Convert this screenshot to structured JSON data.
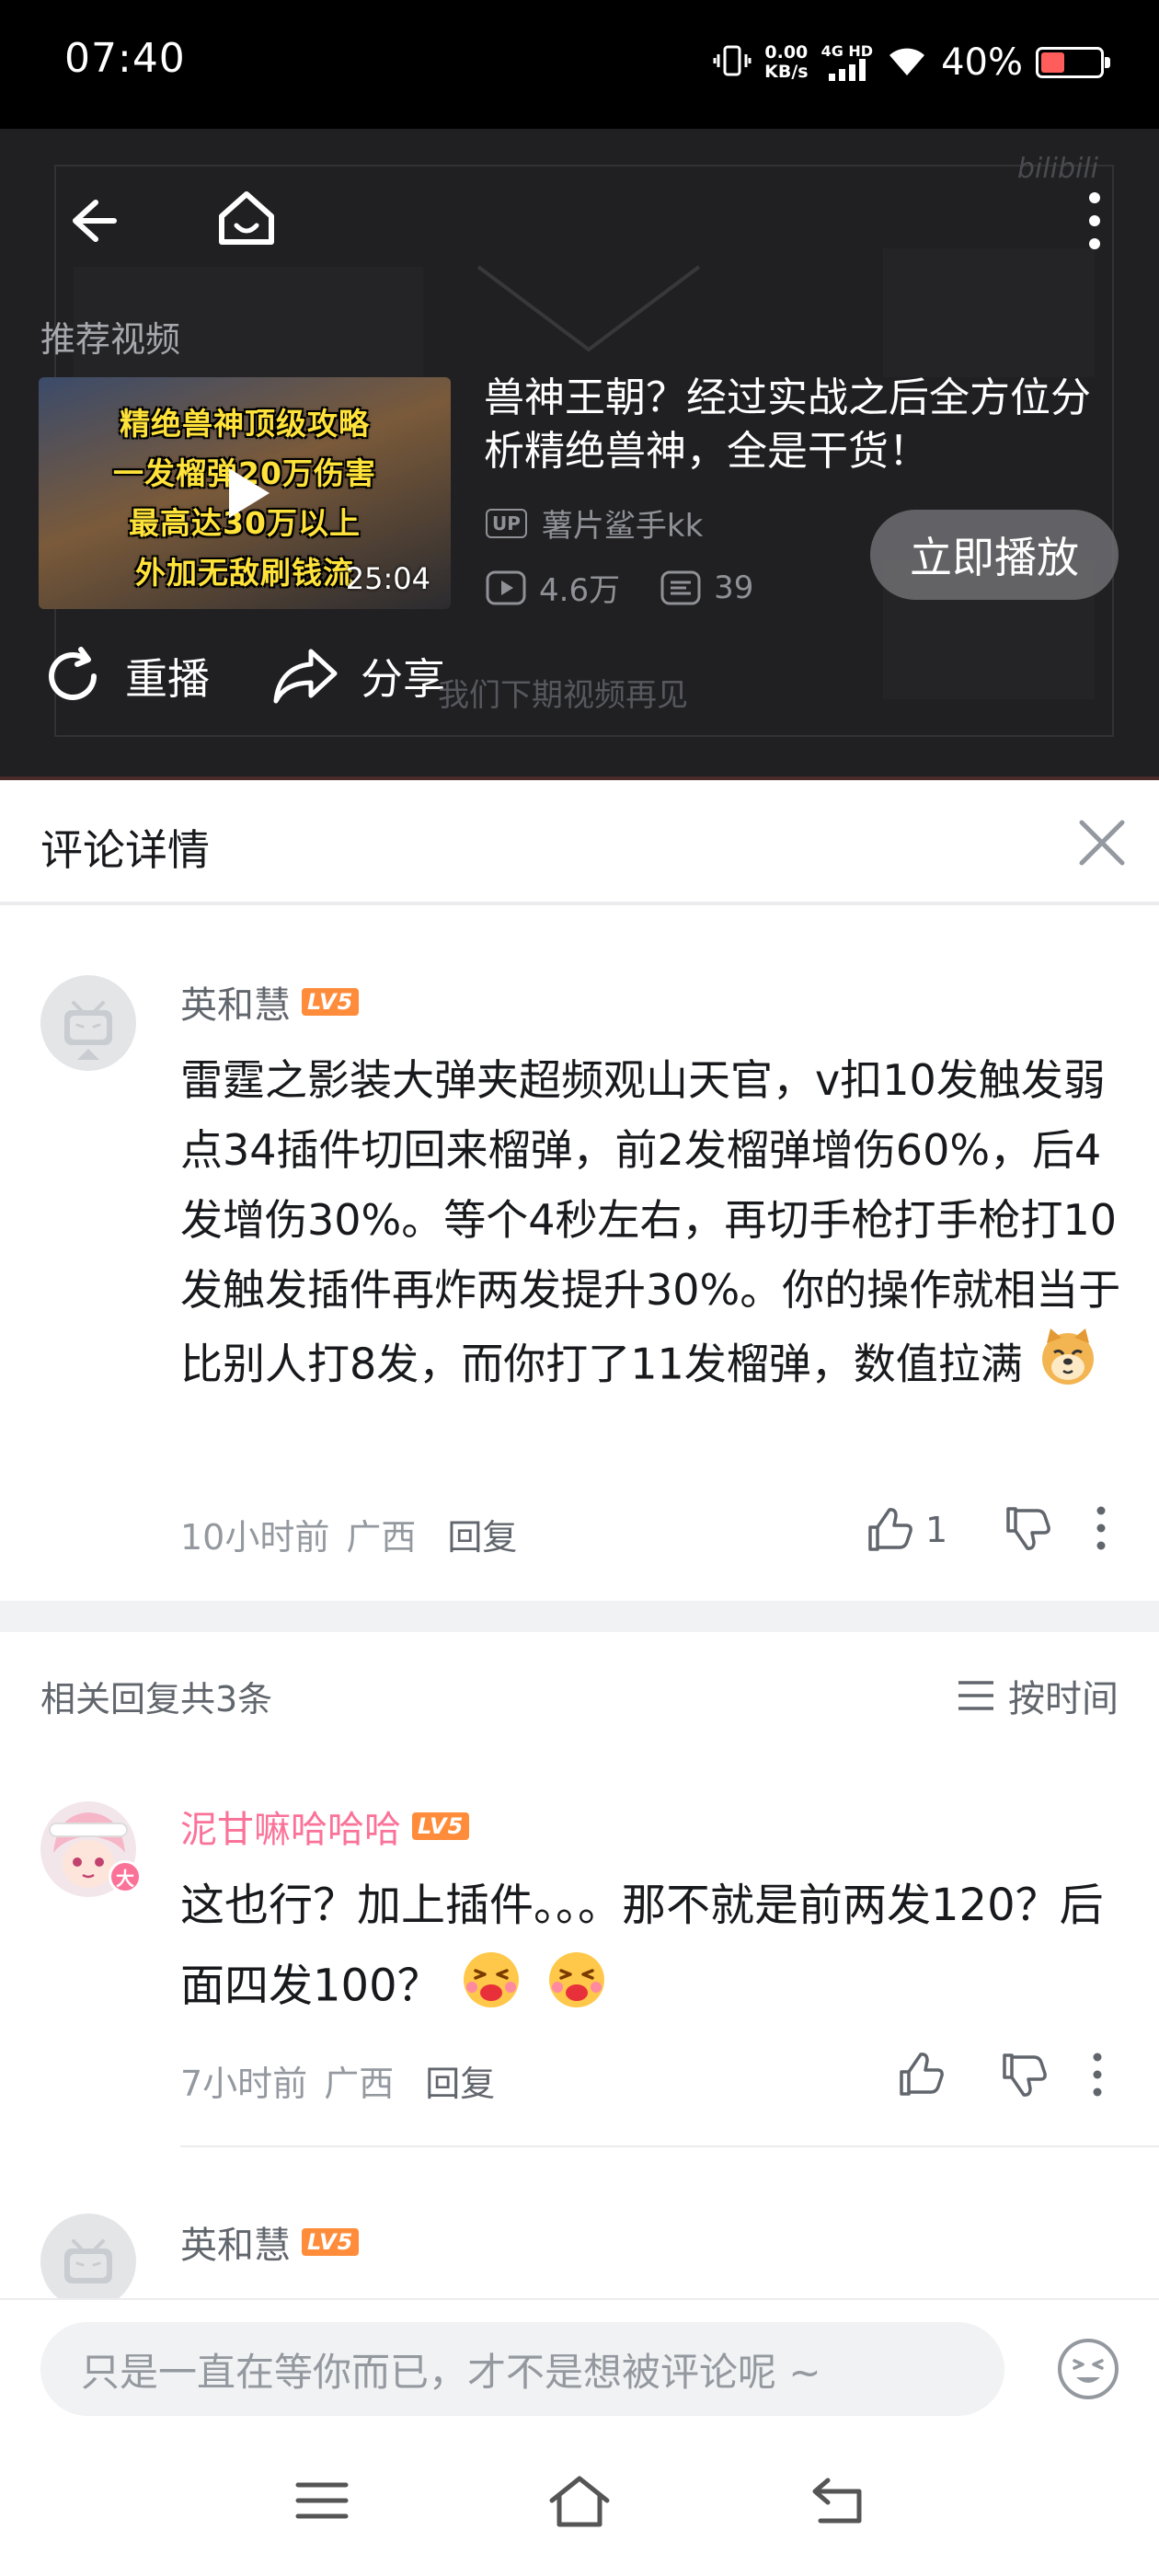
{
  "status_bar": {
    "time": "07:40",
    "net_speed_value": "0.00",
    "net_speed_unit": "KB/s",
    "network_type": "4G HD",
    "battery_percent": "40%",
    "battery_level": 0.4
  },
  "player": {
    "recommend_label": "推荐视频",
    "brand": "bilibili",
    "watermark_text": "我们下期视频再见",
    "video": {
      "thumb_lines": [
        "精绝兽神顶级攻略",
        "一发榴弹20万伤害",
        "最高达30万以上",
        "外加无敌刷钱流"
      ],
      "duration": "25:04",
      "title": "兽神王朝？经过实战之后全方位分析精绝兽神，全是干货！",
      "up_badge": "UP",
      "uploader": "薯片鲨手kk",
      "views": "4.6万",
      "danmaku": "39"
    },
    "play_now_label": "立即播放",
    "replay_label": "重播",
    "share_label": "分享"
  },
  "comment_header": {
    "title": "评论详情"
  },
  "main_comment": {
    "username": "英和慧",
    "level": "LV5",
    "text": "雷霆之影装大弹夹超频观山天官，v扣10发触发弱点34插件切回来榴弹，前2发榴弹增伤60%，后4发增伤30%。等个4秒左右，再切手枪打手枪打10发触发插件再炸两发提升30%。你的操作就相当于比别人打8发，而你打了11发榴弹，数值拉满",
    "time": "10小时前",
    "location": "广西",
    "reply_label": "回复",
    "likes": "1"
  },
  "replies_bar": {
    "count_label": "相关回复共3条",
    "sort_label": "按时间"
  },
  "replies": [
    {
      "username": "泥甘嘛哈哈哈",
      "level": "LV5",
      "badge": "大",
      "text": "这也行？加上插件。。。那不就是前两发120？后面四发100？",
      "time": "7小时前",
      "location": "广西",
      "reply_label": "回复"
    },
    {
      "username": "英和慧",
      "level": "LV5"
    }
  ],
  "input_bar": {
    "placeholder": "只是一直在等你而已，才不是想被评论呢 ~"
  },
  "colors": {
    "pink": "#fb7299",
    "level_orange": "#ff8c3a",
    "battery_low": "#ff5c5c"
  }
}
